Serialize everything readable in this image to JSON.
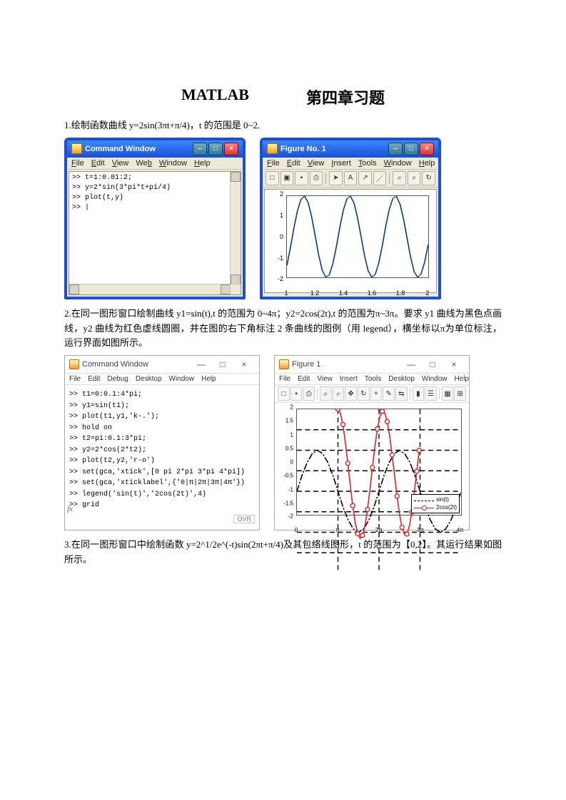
{
  "title": {
    "matlab": "MATLAB",
    "cn": "第四章习题"
  },
  "p1": "1.绘制函数曲线 y=2sin(3πt+π/4)，t 的范围是 0~2.",
  "p2": "2.在同一图形窗口绘制曲线 y1=sin(t),t 的范围为 0~4π；y2=2cos(2t),t 的范围为π~3π。要求 y1 曲线为黑色点画线，y2 曲线为红色虚线圆圈，并在图的右下角标注 2 条曲线的图例（用 legend），横坐标以π为单位标注，运行界面如图所示。",
  "p3": "3.在同一图形窗口中绘制函数 y=2^1/2e^(-t)sin(2πt+π/4)及其包络线图形，t 的范围为【0,2】。其运行结果如图所示。",
  "cmd1": {
    "title": "Command Window",
    "menu": [
      "File",
      "Edit",
      "View",
      "Web",
      "Window",
      "Help"
    ],
    "lines": [
      ">> t=1:0.01:2;",
      ">> y=2*sin(3*pi*t+pi/4)",
      ">> plot(t,y)",
      ">> |"
    ]
  },
  "fig1": {
    "title": "Figure No. 1",
    "menu": [
      "File",
      "Edit",
      "View",
      "Insert",
      "Tools",
      "Window",
      "Help"
    ],
    "toolbar": [
      "new-icon",
      "open-icon",
      "save-icon",
      "print-icon",
      "|",
      "arrow-icon",
      "text-icon",
      "draw-icon",
      "line-icon",
      "|",
      "zoom-in-icon",
      "zoom-out-icon",
      "rotate-icon"
    ]
  },
  "cmd2": {
    "title": "Command Window",
    "menu": [
      "File",
      "Edit",
      "Debug",
      "Desktop",
      "Window",
      "Help"
    ],
    "lines": [
      ">> t1=0:0.1:4*pi;",
      ">> y1=sin(t1);",
      ">> plot(t1,y1,'k-.');",
      ">> hold on",
      ">> t2=pi:0.1:3*pi;",
      ">> y2=2*cos(2*t2);",
      ">> plot(t2,y2,'r-o')",
      ">> set(gca,'xtick',[0 pi 2*pi 3*pi 4*pi])",
      ">> set(gca,'xticklabel',{'0|π|2π|3π|4π'})",
      ">> legend('sin(t)','2cos(2t)',4)",
      ">> grid"
    ],
    "status": "OVR",
    "fx": "fx"
  },
  "fig2": {
    "title": "Figure 1",
    "menu": [
      "File",
      "Edit",
      "View",
      "Insert",
      "Tools",
      "Desktop",
      "Window",
      "Help"
    ],
    "toolbar": [
      "new-icon",
      "save-icon",
      "print-icon",
      "|",
      "zoom-in-icon",
      "zoom-out-icon",
      "pan-icon",
      "rotate-icon",
      "cursor-icon",
      "brush-icon",
      "link-icon",
      "|",
      "colorbar-icon",
      "legend-icon",
      "|",
      "inspect-icon",
      "grid-icon"
    ],
    "legend": {
      "a": "sin(t)",
      "b": "2cos(2t)"
    }
  },
  "chart_data": [
    {
      "type": "line",
      "title": "",
      "xlabel": "",
      "ylabel": "",
      "x_range": [
        1,
        2
      ],
      "y_range": [
        -2,
        2
      ],
      "x_ticks": [
        1,
        1.2,
        1.4,
        1.6,
        1.8,
        2
      ],
      "y_ticks": [
        -2,
        -1,
        0,
        1,
        2
      ],
      "series": [
        {
          "name": "2sin(3πt+π/4)",
          "color": "#003399",
          "x": [
            1,
            1.05,
            1.1,
            1.15,
            1.2,
            1.25,
            1.3,
            1.35,
            1.4,
            1.45,
            1.5,
            1.55,
            1.6,
            1.65,
            1.7,
            1.75,
            1.8,
            1.85,
            1.9,
            1.95,
            2
          ],
          "y": [
            -1.41,
            -0.52,
            0.45,
            1.29,
            1.85,
            2.0,
            1.68,
            0.98,
            0.04,
            -0.91,
            -1.65,
            -1.99,
            -1.87,
            -1.33,
            -0.49,
            0.49,
            1.33,
            1.87,
            1.99,
            1.65,
            0.91
          ]
        }
      ]
    },
    {
      "type": "line",
      "title": "",
      "xlabel": "",
      "ylabel": "",
      "x_range": [
        0,
        12.566
      ],
      "y_range": [
        -2,
        2
      ],
      "x_ticks_labels": [
        "0",
        "π",
        "2π",
        "3π",
        "4π"
      ],
      "x_ticks": [
        0,
        3.1416,
        6.2832,
        9.4248,
        12.5664
      ],
      "y_ticks": [
        -2,
        -1.5,
        -1,
        -0.5,
        0,
        0.5,
        1,
        1.5,
        2
      ],
      "legend_position": "southeast",
      "series": [
        {
          "name": "sin(t)",
          "style": "k-.",
          "color": "#000000",
          "x": [
            0,
            0.79,
            1.57,
            2.36,
            3.14,
            3.93,
            4.71,
            5.5,
            6.28,
            7.07,
            7.85,
            8.64,
            9.42,
            10.21,
            11.0,
            11.78,
            12.57
          ],
          "y": [
            0,
            0.71,
            1.0,
            0.71,
            0,
            -0.71,
            -1.0,
            -0.71,
            0,
            0.71,
            1.0,
            0.71,
            0,
            -0.71,
            -1.0,
            -0.71,
            0
          ]
        },
        {
          "name": "2cos(2t)",
          "style": "r-o",
          "color": "#dd2222",
          "x": [
            3.14,
            3.53,
            3.93,
            4.32,
            4.71,
            5.11,
            5.5,
            5.89,
            6.28,
            6.68,
            7.07,
            7.46,
            7.85,
            8.25,
            8.64,
            9.03,
            9.42
          ],
          "y": [
            2.0,
            1.41,
            0.0,
            -1.41,
            -2.0,
            -1.41,
            0.0,
            1.41,
            2.0,
            1.41,
            0.0,
            -1.41,
            -2.0,
            -1.41,
            0.0,
            1.41,
            2.0
          ]
        }
      ]
    }
  ]
}
